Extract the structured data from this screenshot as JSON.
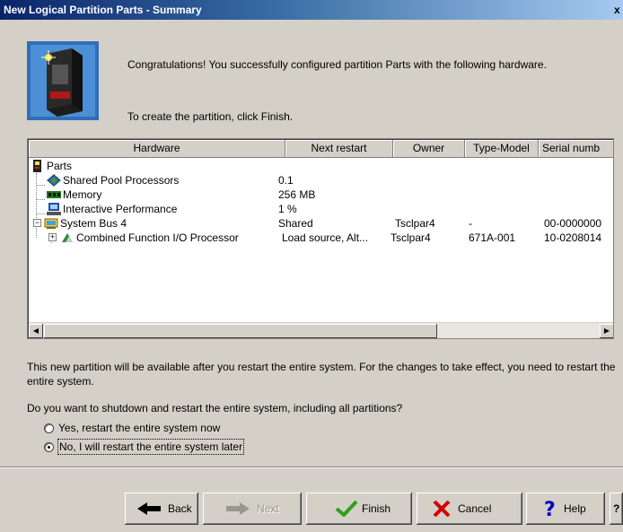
{
  "window": {
    "title": "New Logical Partition Parts - Summary",
    "close_glyph": "x"
  },
  "intro": {
    "line1": "Congratulations! You successfully configured partition Parts with the following hardware.",
    "line2": "To create the partition, click Finish."
  },
  "table": {
    "columns": [
      "Hardware",
      "Next restart",
      "Owner",
      "Type-Model",
      "Serial numb"
    ],
    "rows": [
      {
        "name": "Parts",
        "next_restart": "",
        "owner": "",
        "type_model": "",
        "serial": ""
      },
      {
        "name": "Shared Pool Processors",
        "next_restart": "0.1",
        "owner": "",
        "type_model": "",
        "serial": ""
      },
      {
        "name": "Memory",
        "next_restart": "256 MB",
        "owner": "",
        "type_model": "",
        "serial": ""
      },
      {
        "name": "Interactive Performance",
        "next_restart": "1 %",
        "owner": "",
        "type_model": "",
        "serial": ""
      },
      {
        "name": "System Bus 4",
        "next_restart": "Shared",
        "owner": "Tsclpar4",
        "type_model": "-",
        "serial": "00-0000000"
      },
      {
        "name": "Combined Function I/O Processor",
        "next_restart": "Load source, Alt...",
        "owner": "Tsclpar4",
        "type_model": "671A-001",
        "serial": "10-0208014"
      }
    ]
  },
  "info": "This new partition will be available after you restart the entire system. For the changes to take effect, you need to restart the entire system.",
  "question": "Do you want to shutdown and restart the entire system, including all partitions?",
  "options": [
    {
      "label": "Yes, restart the entire system now",
      "selected": false
    },
    {
      "label": "No, I will restart the entire system later",
      "selected": true
    }
  ],
  "buttons": {
    "back": "Back",
    "next": "Next",
    "finish": "Finish",
    "cancel": "Cancel",
    "help": "Help",
    "overflow": "?"
  },
  "colors": {
    "titlebar": "#0a246a",
    "dialog_bg": "#d4d0c8",
    "finish_check": "#2e9e1e",
    "cancel_x": "#d00000",
    "help_q": "#0000c0"
  }
}
